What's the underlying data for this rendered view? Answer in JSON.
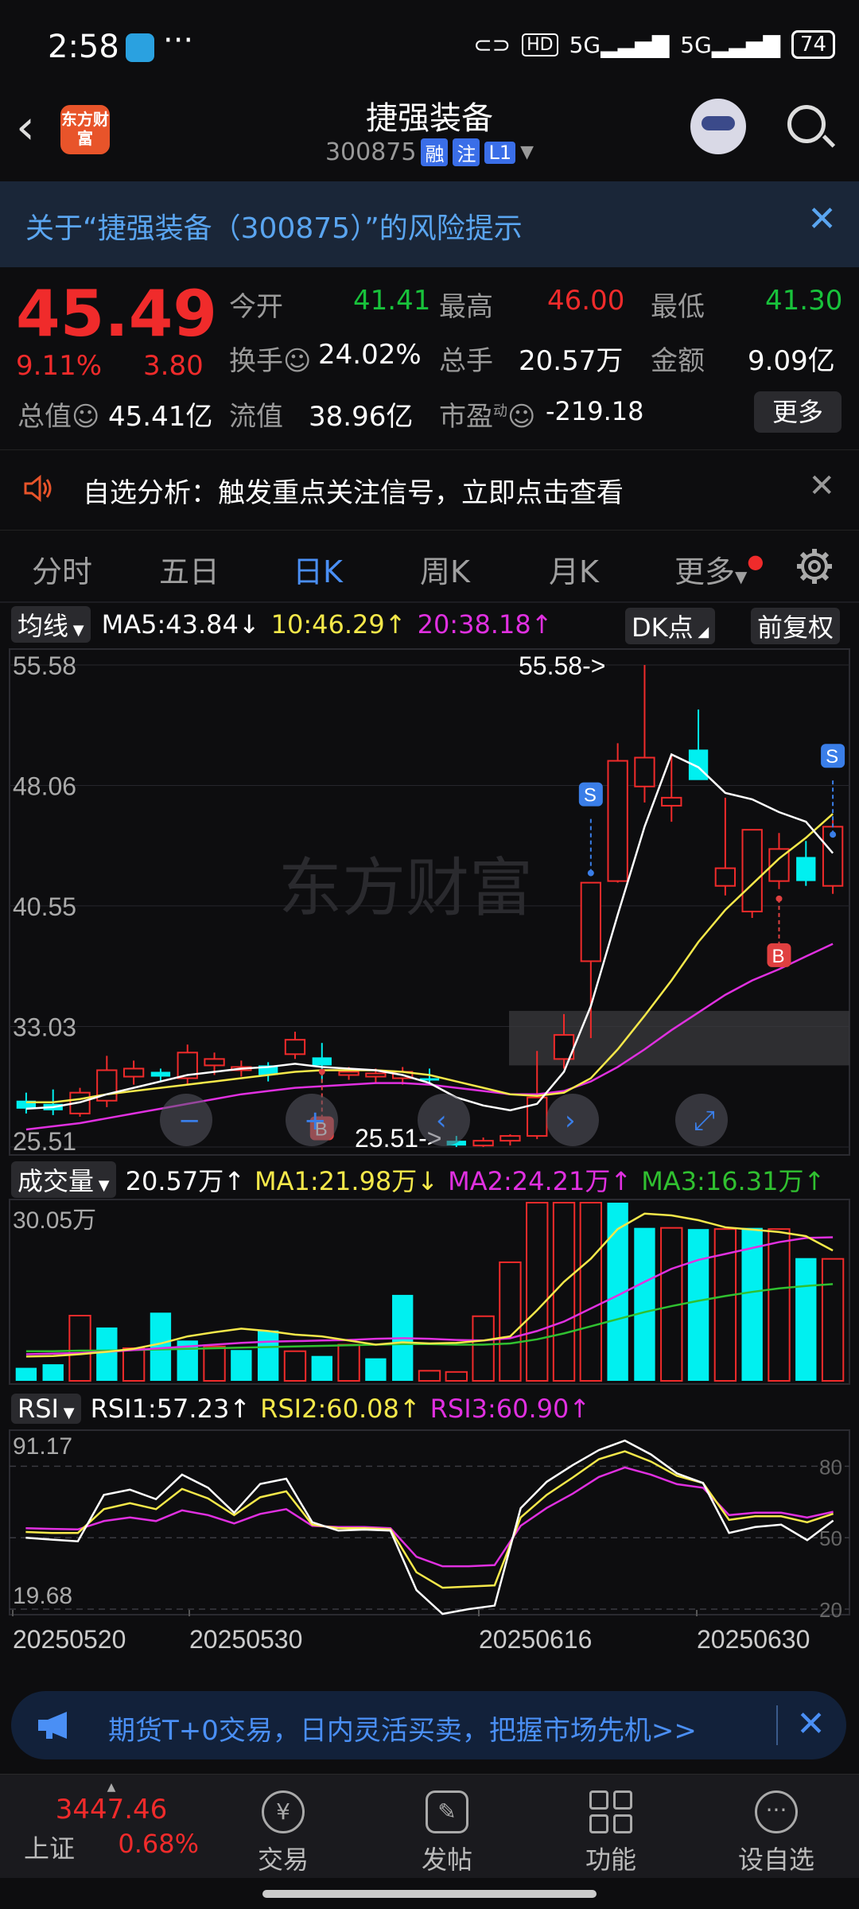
{
  "status": {
    "time": "2:58",
    "battery": "74",
    "network1": "5G",
    "network2": "5G",
    "hd": "HD"
  },
  "header": {
    "title": "捷强装备",
    "code": "300875",
    "tags": [
      "融",
      "注",
      "L1"
    ],
    "logo_text": "东方财富"
  },
  "risk_banner": {
    "text": "关于“捷强装备（300875）”的风险提示"
  },
  "quote": {
    "price": "45.49",
    "change_pct": "9.11%",
    "change": "3.80",
    "open_label": "今开",
    "open": "41.41",
    "high_label": "最高",
    "high": "46.00",
    "low_label": "最低",
    "low": "41.30",
    "turnover_label": "换手",
    "turnover": "24.02%",
    "volume_label": "总手",
    "volume": "20.57万",
    "amount_label": "金额",
    "amount": "9.09亿",
    "mktcap_label": "总值",
    "mktcap": "45.41亿",
    "float_label": "流值",
    "float": "38.96亿",
    "pe_label": "市盈",
    "pe_sup": "动",
    "pe": "-219.18",
    "more_label": "更多"
  },
  "analysis": {
    "text": "自选分析：触发重点关注信号，立即点击查看"
  },
  "tabs": [
    "分时",
    "五日",
    "日K",
    "周K",
    "月K",
    "更多"
  ],
  "active_tab": "日K",
  "ma_bar": {
    "selector": "均线",
    "ma5": "MA5:43.84↓",
    "ma10": "10:46.29↑",
    "ma20": "20:38.18↑",
    "dk": "DK点",
    "adjust": "前复权"
  },
  "vol_bar": {
    "selector": "成交量",
    "vol": "20.57万↑",
    "ma1": "MA1:21.98万↓",
    "ma2": "MA2:24.21万↑",
    "ma3": "MA3:16.31万↑"
  },
  "rsi_bar": {
    "selector": "RSI",
    "rsi1": "RSI1:57.23↑",
    "rsi2": "RSI2:60.08↑",
    "rsi3": "RSI3:60.90↑"
  },
  "colors": {
    "up": "#f02b2b",
    "down": "#18c23b",
    "ma5": "#ffffff",
    "ma10": "#f5e84a",
    "ma20": "#e030e0",
    "ma3": "#30c030",
    "cyan": "#00f0f0",
    "accent": "#4a8ff5"
  },
  "chart_data": [
    {
      "type": "candlestick",
      "title": "",
      "y_ticks": [
        "55.58",
        "48.06",
        "40.55",
        "33.03",
        "25.51"
      ],
      "ylim": [
        25.51,
        55.58
      ],
      "annotations": {
        "max": "55.58->",
        "min": "25.51->"
      },
      "signals": [
        "S",
        "S",
        "B",
        "B"
      ],
      "x_labels": [
        "20250520",
        "20250530",
        "20250616",
        "20250630"
      ],
      "candles": [
        {
          "o": 28.4,
          "h": 28.9,
          "l": 27.6,
          "c": 27.9
        },
        {
          "o": 28.2,
          "h": 29.1,
          "l": 27.5,
          "c": 27.8
        },
        {
          "o": 27.6,
          "h": 29.2,
          "l": 27.4,
          "c": 28.9
        },
        {
          "o": 28.4,
          "h": 31.2,
          "l": 28.0,
          "c": 30.3
        },
        {
          "o": 29.9,
          "h": 30.9,
          "l": 29.4,
          "c": 30.4
        },
        {
          "o": 30.2,
          "h": 30.4,
          "l": 29.6,
          "c": 29.9
        },
        {
          "o": 29.8,
          "h": 31.9,
          "l": 29.4,
          "c": 31.4
        },
        {
          "o": 30.6,
          "h": 31.4,
          "l": 30.0,
          "c": 31.0
        },
        {
          "o": 30.3,
          "h": 30.9,
          "l": 29.9,
          "c": 30.5
        },
        {
          "o": 30.6,
          "h": 30.8,
          "l": 29.6,
          "c": 30.0
        },
        {
          "o": 31.3,
          "h": 32.7,
          "l": 31.0,
          "c": 32.2
        },
        {
          "o": 31.1,
          "h": 32.0,
          "l": 29.5,
          "c": 30.6
        },
        {
          "o": 30.0,
          "h": 30.5,
          "l": 29.7,
          "c": 30.2
        },
        {
          "o": 29.9,
          "h": 30.4,
          "l": 29.5,
          "c": 30.1
        },
        {
          "o": 29.8,
          "h": 30.5,
          "l": 29.4,
          "c": 30.2
        },
        {
          "o": 29.8,
          "h": 30.4,
          "l": 29.4,
          "c": 29.7
        },
        {
          "o": 25.9,
          "h": 26.2,
          "l": 25.51,
          "c": 25.6
        },
        {
          "o": 25.6,
          "h": 26.1,
          "l": 25.51,
          "c": 25.9
        },
        {
          "o": 25.9,
          "h": 26.3,
          "l": 25.6,
          "c": 26.2
        },
        {
          "o": 26.2,
          "h": 31.5,
          "l": 26.0,
          "c": 28.6
        },
        {
          "o": 31.0,
          "h": 33.8,
          "l": 30.4,
          "c": 32.5
        },
        {
          "o": 37.1,
          "h": 41.4,
          "l": 32.3,
          "c": 42.0
        },
        {
          "o": 42.1,
          "h": 50.7,
          "l": 42.0,
          "c": 49.6
        },
        {
          "o": 48.0,
          "h": 55.58,
          "l": 47.0,
          "c": 49.8
        },
        {
          "o": 46.8,
          "h": 49.9,
          "l": 45.8,
          "c": 47.3
        },
        {
          "o": 50.3,
          "h": 52.8,
          "l": 49.8,
          "c": 48.4
        },
        {
          "o": 41.8,
          "h": 47.3,
          "l": 41.2,
          "c": 42.9
        },
        {
          "o": 40.2,
          "h": 45.1,
          "l": 39.8,
          "c": 45.3
        },
        {
          "o": 42.1,
          "h": 45.1,
          "l": 41.6,
          "c": 44.1
        },
        {
          "o": 43.6,
          "h": 44.6,
          "l": 41.8,
          "c": 42.1
        },
        {
          "o": 41.8,
          "h": 46.0,
          "l": 41.3,
          "c": 45.49
        }
      ],
      "ma5": [
        27.9,
        28.0,
        28.3,
        28.8,
        29.2,
        29.6,
        30.0,
        30.2,
        30.4,
        30.5,
        30.7,
        30.5,
        30.4,
        30.3,
        30.0,
        29.5,
        28.6,
        28.1,
        27.8,
        28.2,
        30.2,
        34.3,
        40.0,
        45.5,
        50.0,
        49.2,
        47.6,
        47.2,
        46.4,
        45.8,
        43.84
      ],
      "ma10": [
        28.3,
        28.3,
        28.5,
        28.8,
        29.0,
        29.2,
        29.4,
        29.6,
        29.8,
        30.0,
        30.2,
        30.3,
        30.3,
        30.3,
        30.2,
        30.0,
        29.6,
        29.2,
        28.8,
        28.7,
        28.9,
        29.8,
        31.6,
        33.7,
        35.9,
        38.3,
        40.3,
        41.9,
        43.5,
        44.8,
        46.29
      ],
      "ma20": [
        26.6,
        26.8,
        27.0,
        27.3,
        27.6,
        27.9,
        28.2,
        28.5,
        28.8,
        29.0,
        29.2,
        29.3,
        29.4,
        29.5,
        29.5,
        29.4,
        29.2,
        29.0,
        28.8,
        28.8,
        29.0,
        29.6,
        30.5,
        31.6,
        32.8,
        33.9,
        35.0,
        35.9,
        36.6,
        37.4,
        38.18
      ]
    },
    {
      "type": "bar",
      "title": "成交量",
      "y_ticks": [
        "30.05万"
      ],
      "ylim": [
        0,
        30.05
      ],
      "values": [
        2.2,
        2.8,
        11.0,
        9.0,
        5.5,
        11.5,
        6.8,
        5.8,
        5.2,
        8.5,
        5.0,
        4.2,
        6.1,
        3.8,
        14.5,
        1.7,
        1.5,
        10.9,
        20.0,
        30.05,
        30.05,
        30.05,
        30.05,
        25.8,
        25.8,
        25.6,
        25.6,
        25.8,
        25.6,
        20.7,
        20.57
      ],
      "colors": [
        "down",
        "down",
        "up",
        "down",
        "up",
        "down",
        "down",
        "up",
        "down",
        "down",
        "up",
        "down",
        "up",
        "down",
        "down",
        "up",
        "up",
        "up",
        "up",
        "up",
        "up",
        "up",
        "down",
        "down",
        "up",
        "down",
        "up",
        "down",
        "up",
        "down",
        "up"
      ],
      "ma1": [
        4.1,
        4.2,
        4.5,
        4.9,
        5.4,
        6.3,
        7.5,
        8.2,
        8.8,
        8.4,
        7.8,
        7.5,
        6.8,
        6.1,
        6.5,
        6.3,
        6.4,
        6.8,
        7.5,
        11.9,
        16.7,
        20.6,
        25.6,
        28.2,
        27.9,
        27.1,
        25.9,
        25.5,
        25.1,
        24.4,
        21.98
      ],
      "ma2": [
        4.5,
        4.6,
        4.7,
        4.9,
        5.2,
        5.5,
        5.8,
        6.1,
        6.4,
        6.6,
        6.7,
        6.8,
        6.9,
        7.1,
        7.2,
        7.1,
        6.9,
        6.8,
        7.2,
        8.4,
        10.0,
        12.2,
        14.4,
        16.7,
        18.9,
        20.4,
        21.4,
        22.4,
        23.4,
        24.1,
        24.21
      ],
      "ma3": [
        5.0,
        5.0,
        5.1,
        5.1,
        5.2,
        5.3,
        5.4,
        5.5,
        5.6,
        5.7,
        5.8,
        5.9,
        6.0,
        6.1,
        6.2,
        6.2,
        6.1,
        6.1,
        6.3,
        7.0,
        8.0,
        9.2,
        10.4,
        11.6,
        12.6,
        13.5,
        14.3,
        15.0,
        15.6,
        16.0,
        16.31
      ]
    },
    {
      "type": "line",
      "title": "RSI",
      "y_ticks": [
        "91.17",
        "19.68"
      ],
      "right_ticks": [
        "80",
        "50",
        "20"
      ],
      "ylim": [
        19.68,
        91.17
      ],
      "rsi1": [
        50.0,
        49.2,
        48.5,
        68.0,
        70.2,
        66.2,
        76.5,
        71.0,
        60.5,
        72.6,
        74.8,
        56.5,
        53.0,
        53.4,
        53.0,
        28.0,
        18.0,
        20.0,
        21.5,
        62.4,
        73.5,
        80.5,
        86.8,
        90.8,
        85.0,
        77.0,
        73.0,
        52.0,
        54.5,
        55.5,
        49.0,
        57.23
      ],
      "rsi2": [
        52.4,
        52.0,
        52.0,
        62.0,
        64.5,
        62.0,
        70.5,
        66.5,
        59.5,
        67.0,
        69.5,
        55.5,
        54.0,
        54.0,
        53.5,
        35.5,
        29.0,
        29.5,
        30.0,
        58.5,
        68.0,
        75.3,
        83.0,
        86.3,
        82.0,
        76.0,
        73.0,
        57.5,
        59.0,
        59.0,
        56.5,
        60.08
      ],
      "rsi3": [
        54.0,
        53.7,
        53.5,
        57.0,
        58.5,
        57.0,
        61.5,
        59.5,
        56.0,
        60.0,
        62.0,
        55.0,
        54.5,
        54.5,
        54.0,
        42.0,
        38.0,
        38.0,
        38.5,
        55.0,
        62.5,
        68.5,
        75.5,
        79.5,
        76.5,
        72.5,
        71.0,
        59.5,
        60.5,
        60.5,
        58.5,
        60.9
      ]
    }
  ],
  "bottom_ad": {
    "text": "期货T+0交易，日内灵活买卖，把握市场先机>>"
  },
  "bottom_nav": {
    "index_value": "3447.46",
    "index_name": "上证",
    "index_pct": "0.68%",
    "items": [
      "交易",
      "发帖",
      "功能",
      "设自选"
    ]
  }
}
